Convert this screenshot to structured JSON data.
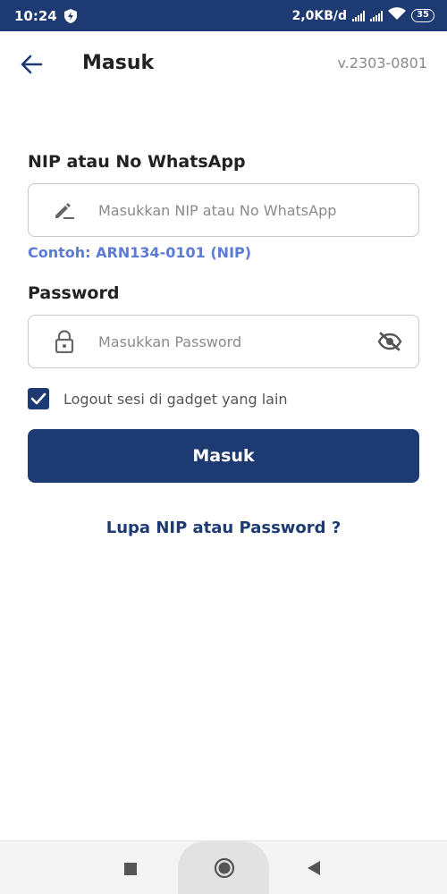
{
  "status_bar": {
    "time": "10:24",
    "network_speed": "2,0KB/d",
    "battery": "35"
  },
  "header": {
    "back_icon": "arrow-left-icon",
    "title": "Masuk",
    "version": "v.2303-0801"
  },
  "form": {
    "nip_label": "NIP atau No WhatsApp",
    "nip_placeholder": "Masukkan NIP atau No WhatsApp",
    "nip_value": "",
    "nip_hint": "Contoh: ARN134-0101 (NIP)",
    "password_label": "Password",
    "password_placeholder": "Masukkan Password",
    "password_value": "",
    "logout_other_label": "Logout sesi di gadget yang lain",
    "logout_other_checked": true,
    "submit_label": "Masuk",
    "forgot_label": "Lupa NIP atau Password  ?"
  },
  "colors": {
    "primary": "#1e3a73",
    "hint": "#5b7bd6"
  }
}
